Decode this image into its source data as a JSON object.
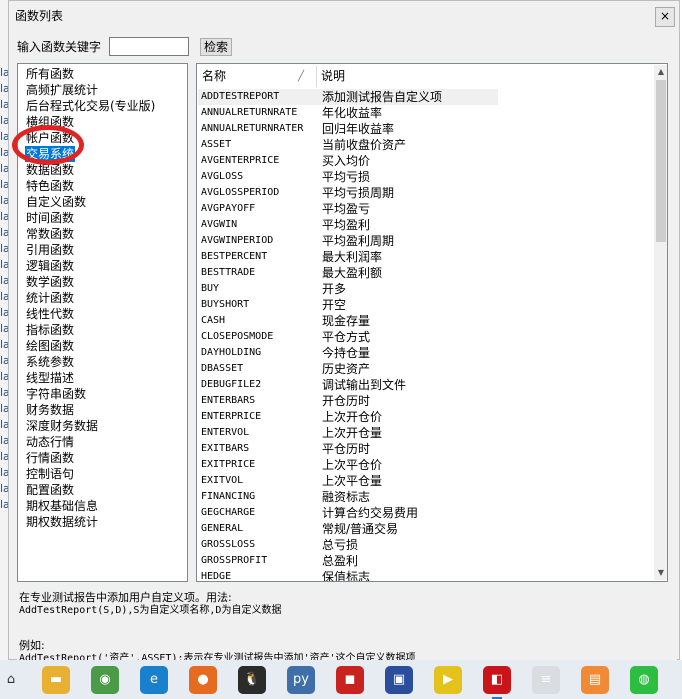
{
  "background_fragments": [
    "la",
    "la",
    "la",
    "la",
    "la",
    "la",
    "la",
    "la",
    "la",
    "la",
    "la",
    "la",
    "la",
    "la",
    "la",
    "la",
    "la",
    "la",
    "la",
    "la",
    "la",
    "la",
    "la",
    "la",
    "la",
    "la",
    "la",
    "la"
  ],
  "dialog": {
    "title": "函数列表",
    "close_label": "×",
    "search": {
      "label": "输入函数关键字",
      "value": "",
      "placeholder": "",
      "button": "检索"
    }
  },
  "categories": [
    "所有函数",
    "高频扩展统计",
    "后台程式化交易(专业版)",
    "横组函数",
    "帐户函数",
    "交易系统",
    "数据函数",
    "特色函数",
    "自定义函数",
    "时间函数",
    "常数函数",
    "引用函数",
    "逻辑函数",
    "数学函数",
    "统计函数",
    "线性代数",
    "指标函数",
    "绘图函数",
    "系统参数",
    "线型描述",
    "字符串函数",
    "财务数据",
    "深度财务数据",
    "动态行情",
    "行情函数",
    "控制语句",
    "配置函数",
    "期权基础信息",
    "期权数据统计"
  ],
  "selected_category": "交易系统",
  "columns": {
    "name": "名称",
    "desc": "说明"
  },
  "functions": [
    {
      "name": "ADDTESTREPORT",
      "desc": "添加测试报告自定义项"
    },
    {
      "name": "ANNUALRETURNRATE",
      "desc": "年化收益率"
    },
    {
      "name": "ANNUALRETURNRATER",
      "desc": "回归年收益率"
    },
    {
      "name": "ASSET",
      "desc": "当前收盘价资产"
    },
    {
      "name": "AVGENTERPRICE",
      "desc": "买入均价"
    },
    {
      "name": "AVGLOSS",
      "desc": "平均亏损"
    },
    {
      "name": "AVGLOSSPERIOD",
      "desc": "平均亏损周期"
    },
    {
      "name": "AVGPAYOFF",
      "desc": "平均盈亏"
    },
    {
      "name": "AVGWIN",
      "desc": "平均盈利"
    },
    {
      "name": "AVGWINPERIOD",
      "desc": "平均盈利周期"
    },
    {
      "name": "BESTPERCENT",
      "desc": "最大利润率"
    },
    {
      "name": "BESTTRADE",
      "desc": "最大盈利额"
    },
    {
      "name": "BUY",
      "desc": "开多"
    },
    {
      "name": "BUYSHORT",
      "desc": "开空"
    },
    {
      "name": "CASH",
      "desc": "现金存量"
    },
    {
      "name": "CLOSEPOSMODE",
      "desc": "平仓方式"
    },
    {
      "name": "DAYHOLDING",
      "desc": "今持仓量"
    },
    {
      "name": "DBASSET",
      "desc": "历史资产"
    },
    {
      "name": "DEBUGFILE2",
      "desc": "调试输出到文件"
    },
    {
      "name": "ENTERBARS",
      "desc": "开仓历时"
    },
    {
      "name": "ENTERPRICE",
      "desc": "上次开仓价"
    },
    {
      "name": "ENTERVOL",
      "desc": "上次开仓量"
    },
    {
      "name": "EXITBARS",
      "desc": "平仓历时"
    },
    {
      "name": "EXITPRICE",
      "desc": "上次平仓价"
    },
    {
      "name": "EXITVOL",
      "desc": "上次平仓量"
    },
    {
      "name": "FINANCING",
      "desc": "融资标志"
    },
    {
      "name": "GEGCHARGE",
      "desc": "计算合约交易费用"
    },
    {
      "name": "GENERAL",
      "desc": "常规/普通交易"
    },
    {
      "name": "GROSSLOSS",
      "desc": "总亏损"
    },
    {
      "name": "GROSSPROFIT",
      "desc": "总盈利"
    },
    {
      "name": "HEDGE",
      "desc": "保值标志"
    }
  ],
  "selected_function": "ADDTESTREPORT",
  "description_lines": [
    "在专业测试报告中添加用户自定义项。用法:",
    "AddTestReport(S,D),S为自定义项名称,D为自定义数据",
    "",
    "例如:",
    "AddTestReport('资产',ASSET);表示在专业测试报告中添加'资产'这个自定义数据项"
  ],
  "taskbar": {
    "apps": [
      {
        "name": "file-explorer-icon",
        "glyph": "▬",
        "color": "#e8b033"
      },
      {
        "name": "chrome-icon",
        "glyph": "◉",
        "color": "#4a9a48"
      },
      {
        "name": "edge-icon",
        "glyph": "e",
        "color": "#1a7fcc"
      },
      {
        "name": "firefox-icon",
        "glyph": "●",
        "color": "#e66a1f"
      },
      {
        "name": "qq-icon",
        "glyph": "🐧",
        "color": "#2b2b2b"
      },
      {
        "name": "python-icon",
        "glyph": "py",
        "color": "#3f6fa8"
      },
      {
        "name": "app-red-icon",
        "glyph": "◼",
        "color": "#c8231f"
      },
      {
        "name": "app-blue-icon",
        "glyph": "▣",
        "color": "#2a4d9c"
      },
      {
        "name": "player-icon",
        "glyph": "▶",
        "color": "#e4c21c"
      },
      {
        "name": "app-active-icon",
        "glyph": "◧",
        "color": "#c9151a"
      },
      {
        "name": "app-stripe-icon",
        "glyph": "≡",
        "color": "#d9dce0"
      },
      {
        "name": "briefcase-icon",
        "glyph": "▤",
        "color": "#f08a35"
      },
      {
        "name": "wechat-icon",
        "glyph": "◍",
        "color": "#2dbd40"
      }
    ],
    "start_label": "⌂"
  }
}
